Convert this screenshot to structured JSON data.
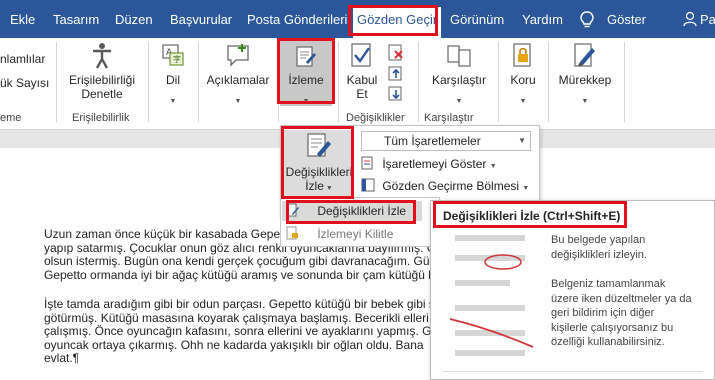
{
  "tabs": [
    {
      "label": "Ekle"
    },
    {
      "label": "Tasarım"
    },
    {
      "label": "Düzen"
    },
    {
      "label": "Başvurular"
    },
    {
      "label": "Posta Gönderileri"
    },
    {
      "label": "Gözden Geçir"
    },
    {
      "label": "Görünüm"
    },
    {
      "label": "Yardım"
    },
    {
      "label": "Göster"
    },
    {
      "label": "Pay"
    }
  ],
  "ribbon": {
    "partial_left": {
      "line1": "nlamlılar",
      "line2": "ük Sayısı",
      "group": "eme"
    },
    "erisilebilirlik": {
      "line1": "Erişilebilirliği",
      "line2": "Denetle",
      "group": "Erişilebilirlik"
    },
    "dil": {
      "label": "Dil"
    },
    "aciklamalar": {
      "label": "Açıklamalar"
    },
    "izleme": {
      "label": "İzleme"
    },
    "kabul": {
      "line1": "Kabul",
      "line2": "Et"
    },
    "degisiklikler_group": "Değişiklikler",
    "karsilastir": {
      "label": "Karşılaştır",
      "group": "Karşılaştır"
    },
    "koru": {
      "label": "Koru"
    },
    "murekkep": {
      "label": "Mürekkep"
    }
  },
  "izleme_panel": {
    "track_line1": "Değişiklikleri",
    "track_line2": "İzle",
    "markup_select": "Tüm İşaretlemeler",
    "show_markup": "İşaretlemeyi Göster",
    "review_pane": "Gözden Geçirme Bölmesi",
    "menu_track": "Değişiklikleri İzle",
    "menu_lock": "İzlemeyi Kilitle"
  },
  "tooltip": {
    "title": "Değişiklikleri İzle (Ctrl+Shift+E)",
    "desc1": [
      "Bu belgede yapılan",
      "değişiklikleri izleyin."
    ],
    "desc2": [
      "Belgeniz tamamlanmak",
      "üzere iken düzeltmeler ya da",
      "geri bildirim için diğer",
      "kişilerle çalışıyorsanız bu",
      "özelliği kullanabilirsiniz."
    ]
  },
  "document": {
    "para1": [
      "Uzun zaman önce küçük bir kasabada Gepett",
      "yapıp satarmış. Çocuklar onun göz alıcı renkli oyuncaklarına bayılırmış. G",
      "olsun istermiş. Bugün ona kendi gerçek çocuğum gibi davranacağım. Gü",
      "Gepetto ormanda iyi bir ağaç kütüğü aramış ve sonunda bir çam kütüğü b"
    ],
    "para2": [
      "İşte tamda aradığım gibi bir odun parçası. Gepetto kütüğü bir bebek gibi s",
      "götürmüş. Kütüğü masasına koyarak çalışmaya başlamış. Becerikli elleri",
      "çalışmış. Önce oyuncağın kafasını, sonra ellerini ve ayaklarını yapmış. Ge",
      "oyuncak ortaya çıkarmış. Ohh ne kadarda yakışıklı bir oğlan oldu. Bana",
      "evlat.¶"
    ]
  },
  "colors": {
    "accent": "#2b579a",
    "highlight_box": "#e0101c"
  }
}
